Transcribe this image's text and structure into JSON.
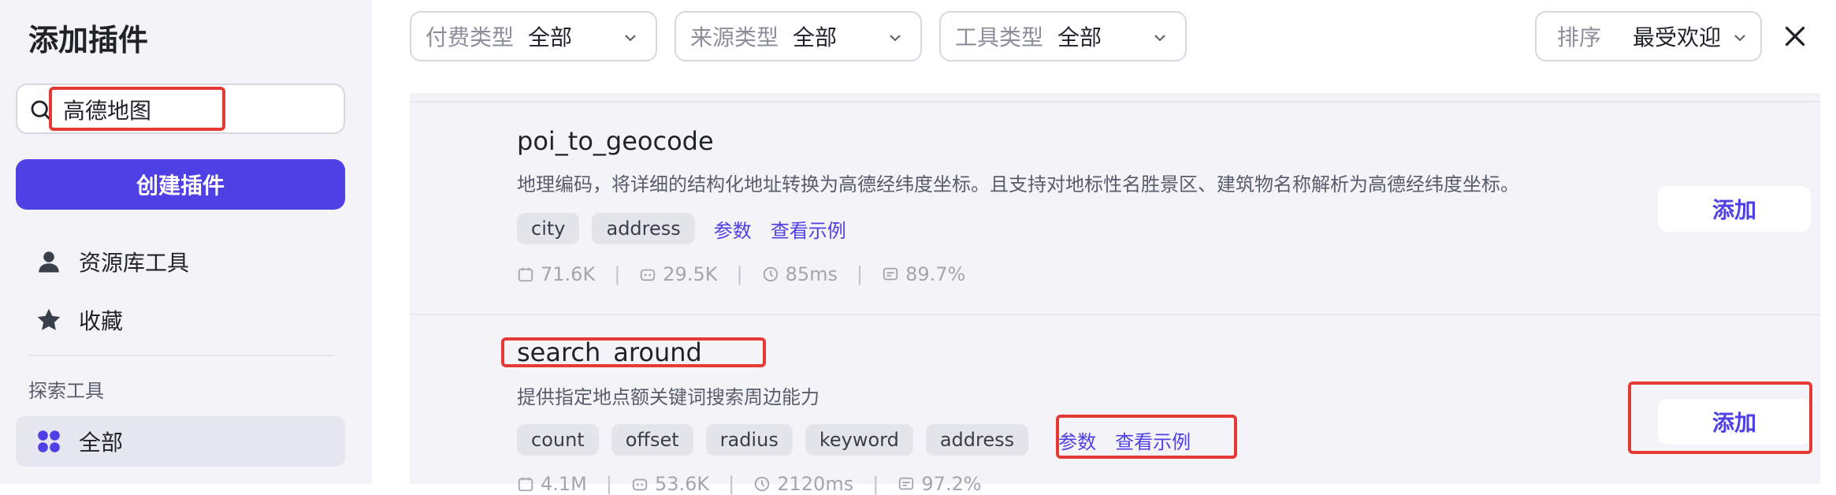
{
  "sidebar": {
    "title": "添加插件",
    "search": {
      "value": "高德地图",
      "placeholder": ""
    },
    "create_label": "创建插件",
    "nav": [
      {
        "label": "资源库工具",
        "icon": "user-icon"
      },
      {
        "label": "收藏",
        "icon": "star-icon"
      }
    ],
    "section_label": "探索工具",
    "explore": [
      {
        "label": "全部",
        "icon": "grid-icon",
        "active": true
      }
    ]
  },
  "filters": [
    {
      "label": "付费类型",
      "value": "全部"
    },
    {
      "label": "来源类型",
      "value": "全部"
    },
    {
      "label": "工具类型",
      "value": "全部"
    }
  ],
  "sort": {
    "label": "排序",
    "value": "最受欢迎"
  },
  "tools": [
    {
      "name": "poi_to_geocode",
      "description": "地理编码，将详细的结构化地址转换为高德经纬度坐标。且支持对地标性名胜景区、建筑物名称解析为高德经纬度坐标。",
      "tags": [
        "city",
        "address"
      ],
      "params_label": "参数",
      "example_label": "查看示例",
      "stats": [
        "71.6K",
        "29.5K",
        "85ms",
        "89.7%"
      ],
      "add_label": "添加"
    },
    {
      "name": "search_around",
      "description": "提供指定地点额关键词搜索周边能力",
      "tags": [
        "count",
        "offset",
        "radius",
        "keyword",
        "address"
      ],
      "params_label": "参数",
      "example_label": "查看示例",
      "stats": [
        "4.1M",
        "53.6K",
        "2120ms",
        "97.2%"
      ],
      "add_label": "添加"
    }
  ],
  "colors": {
    "accent": "#4e40e5",
    "highlight": "#e53935",
    "panel_bg": "#f4f4f8"
  }
}
